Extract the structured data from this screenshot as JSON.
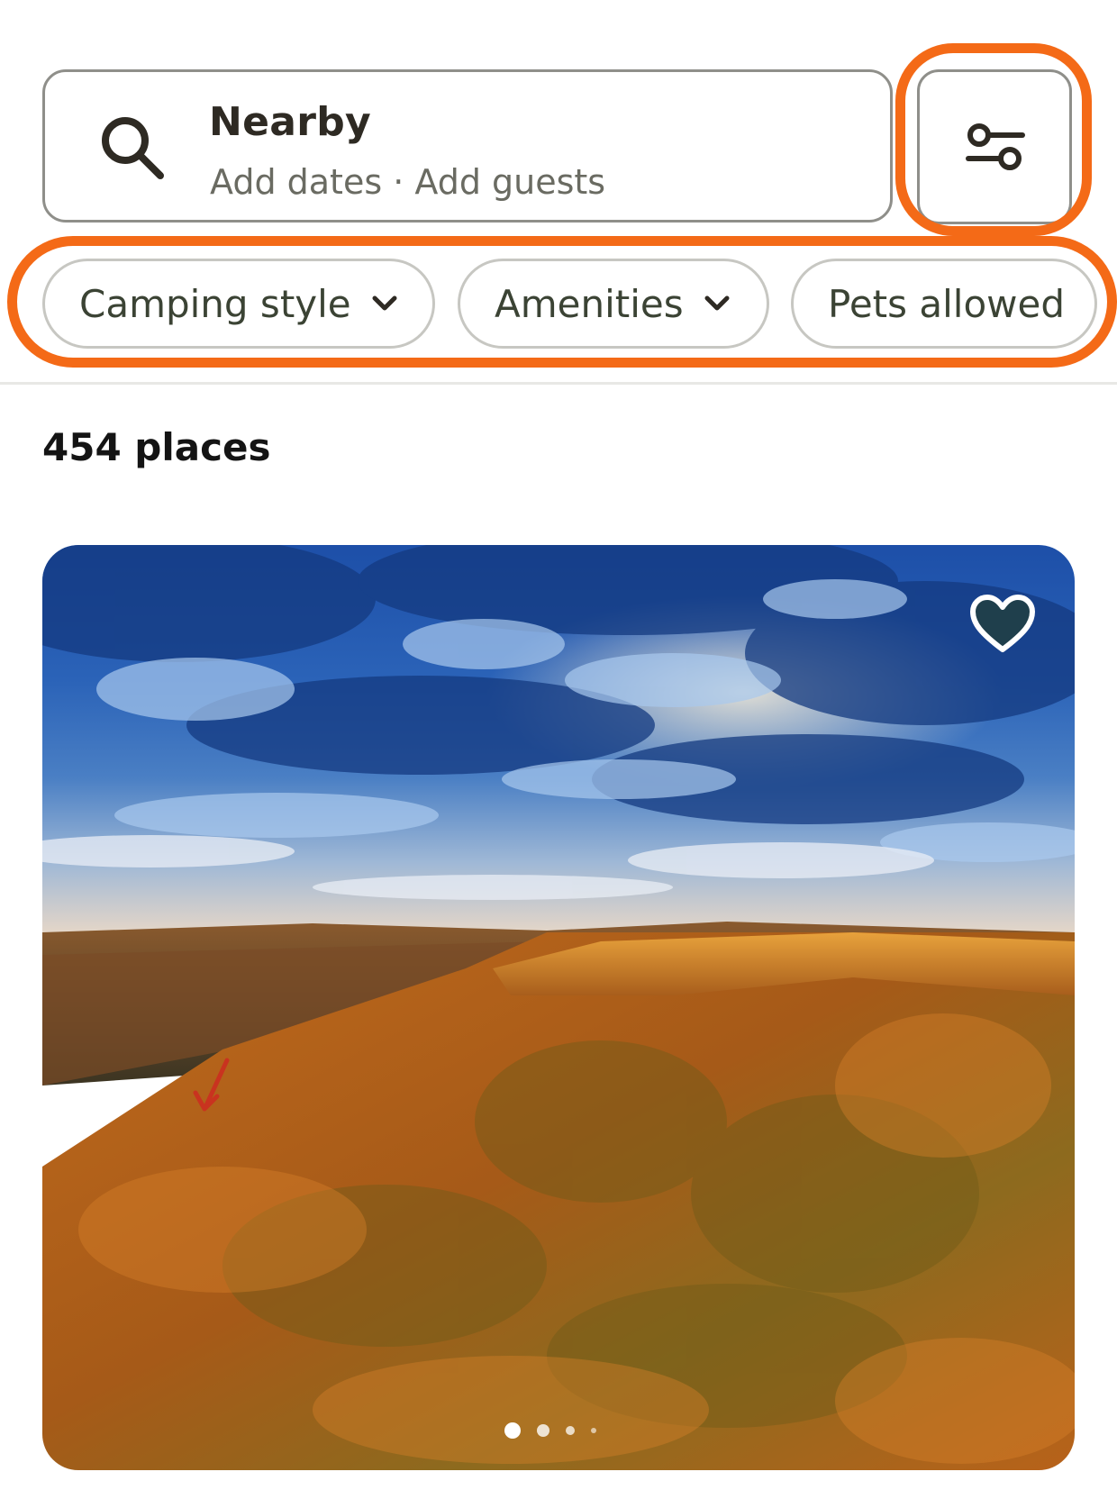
{
  "search": {
    "title": "Nearby",
    "subtitle": "Add dates · Add guests",
    "icon": "search-icon"
  },
  "filter_button": {
    "icon": "sliders-icon"
  },
  "chips": [
    {
      "label": "Camping style",
      "icon": "chevron-down-icon"
    },
    {
      "label": "Amenities",
      "icon": "chevron-down-icon"
    },
    {
      "label": "Pets allowed"
    }
  ],
  "results": {
    "count_label": "454 places"
  },
  "listing": {
    "favorite_icon": "heart-icon",
    "carousel_total_dots": 4,
    "carousel_active_index": 0
  },
  "colors": {
    "highlight": "#f46a17",
    "text_primary": "#2e2a23",
    "text_secondary": "#6a6b62",
    "chip_text": "#3b4334",
    "heart_fill": "#1f3f4c"
  }
}
